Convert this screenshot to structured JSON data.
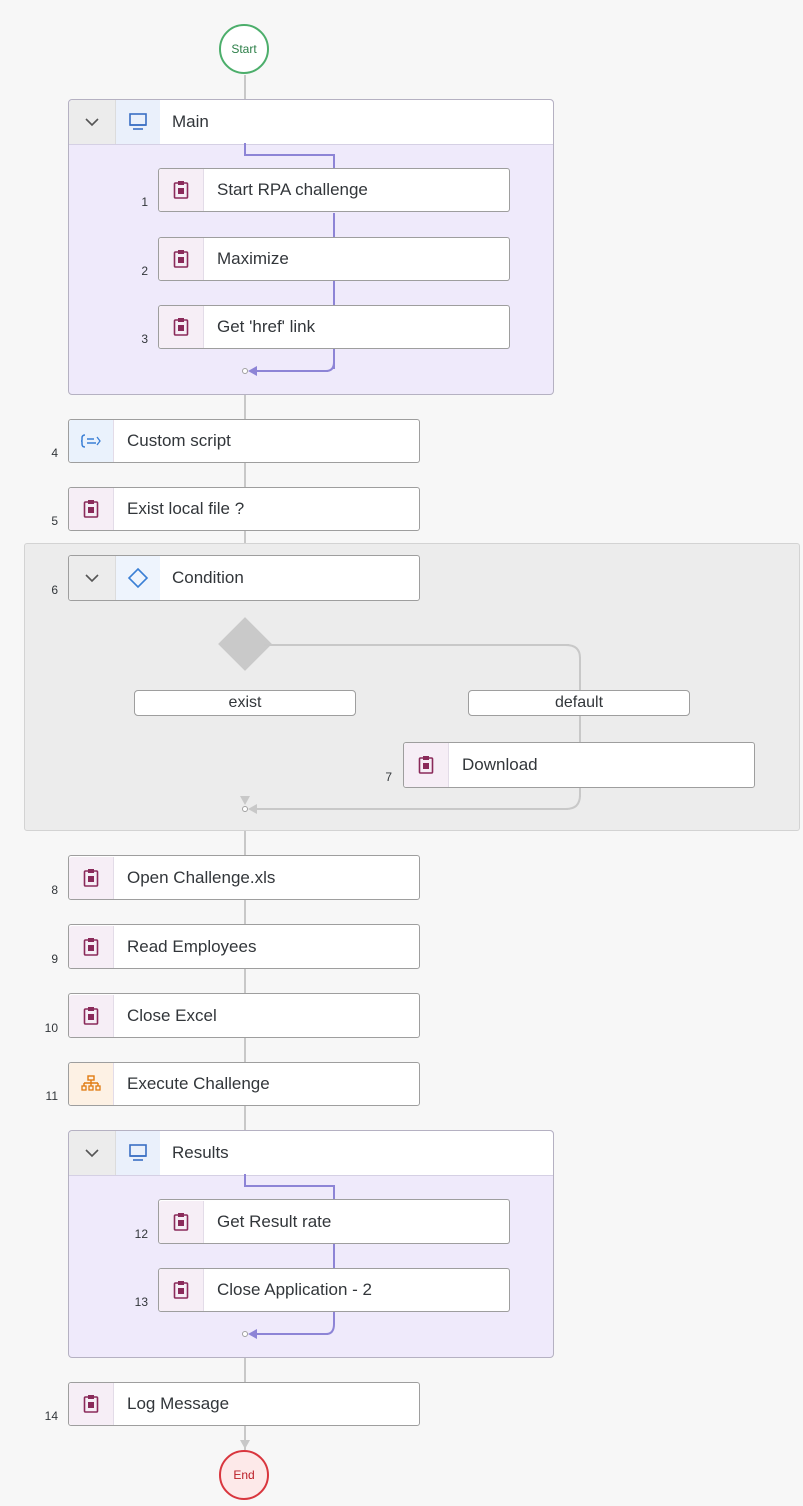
{
  "start_label": "Start",
  "end_label": "End",
  "main_group": {
    "label": "Main"
  },
  "results_group": {
    "label": "Results"
  },
  "condition": {
    "label": "Condition",
    "branch_exist": "exist",
    "branch_default": "default"
  },
  "steps": [
    {
      "num": "1",
      "label": "Start RPA challenge",
      "icon": "clipboard-icon"
    },
    {
      "num": "2",
      "label": "Maximize",
      "icon": "clipboard-icon"
    },
    {
      "num": "3",
      "label": "Get 'href' link",
      "icon": "clipboard-icon"
    },
    {
      "num": "4",
      "label": "Custom script",
      "icon": "script-icon"
    },
    {
      "num": "5",
      "label": "Exist local file ?",
      "icon": "clipboard-icon"
    },
    {
      "num": "6",
      "label": "Condition",
      "icon": "diamond-icon"
    },
    {
      "num": "7",
      "label": "Download",
      "icon": "clipboard-icon"
    },
    {
      "num": "8",
      "label": "Open Challenge.xls",
      "icon": "clipboard-icon"
    },
    {
      "num": "9",
      "label": "Read Employees",
      "icon": "clipboard-icon"
    },
    {
      "num": "10",
      "label": "Close Excel",
      "icon": "clipboard-icon"
    },
    {
      "num": "11",
      "label": "Execute Challenge",
      "icon": "hierarchy-icon"
    },
    {
      "num": "12",
      "label": "Get Result rate",
      "icon": "clipboard-icon"
    },
    {
      "num": "13",
      "label": "Close Application - 2",
      "icon": "clipboard-icon"
    },
    {
      "num": "14",
      "label": "Log Message",
      "icon": "clipboard-icon"
    }
  ],
  "colors": {
    "start_border": "#4cae6b",
    "end_border": "#d9363e",
    "group_bg": "#efeafb",
    "group_connector": "#8d84d6",
    "activity_icon": "#8a2a5a",
    "script_icon": "#3a7fd5",
    "hierarchy_icon": "#e07a10"
  }
}
